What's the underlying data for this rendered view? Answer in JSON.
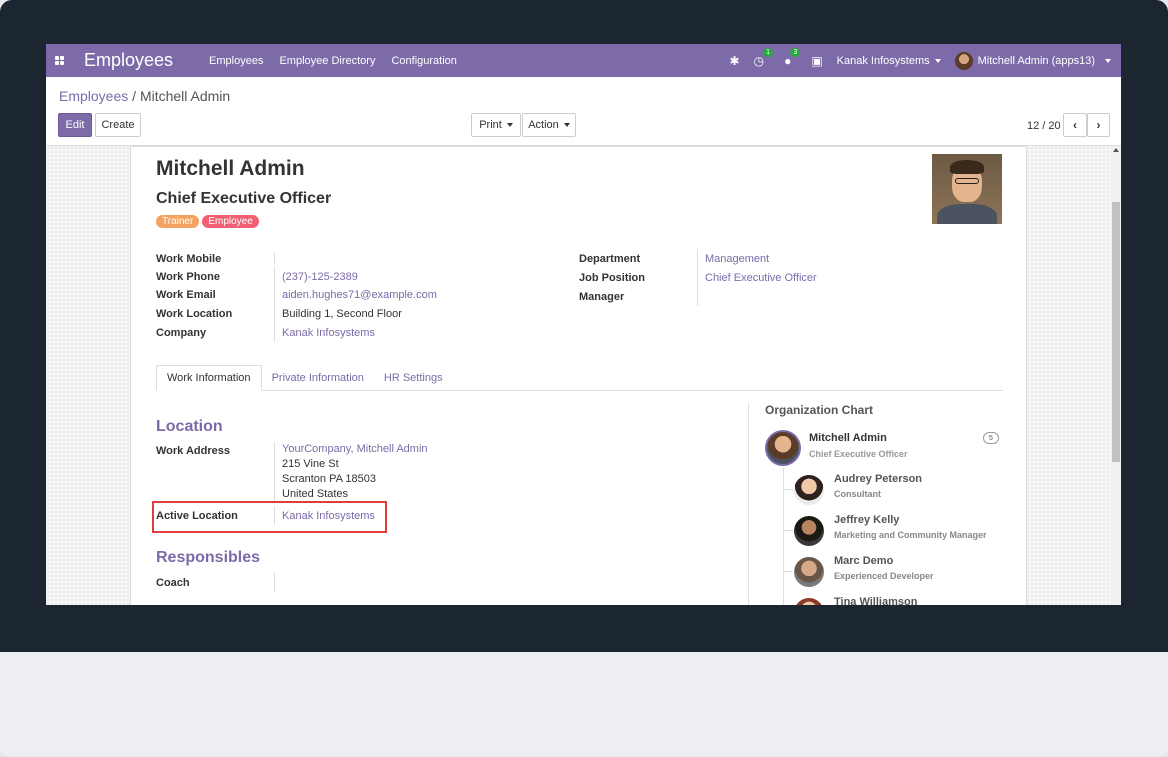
{
  "navbar": {
    "brand": "Employees",
    "menu": [
      "Employees",
      "Employee Directory",
      "Configuration"
    ],
    "activity_count": "1",
    "message_count": "3",
    "company": "Kanak Infosystems",
    "user": "Mitchell Admin (apps13)"
  },
  "control": {
    "breadcrumb_root": "Employees",
    "breadcrumb_sep": "/",
    "breadcrumb_current": "Mitchell Admin",
    "edit_label": "Edit",
    "create_label": "Create",
    "print_label": "Print",
    "action_label": "Action",
    "pager": "12 / 20"
  },
  "employee": {
    "name": "Mitchell Admin",
    "job_title": "Chief Executive Officer",
    "tags": [
      {
        "label": "Trainer",
        "color": "#f4a460"
      },
      {
        "label": "Employee",
        "color": "#f06072"
      }
    ],
    "left_fields": [
      {
        "label": "Work Mobile",
        "value": ""
      },
      {
        "label": "Work Phone",
        "value": "(237)-125-2389"
      },
      {
        "label": "Work Email",
        "value": "aiden.hughes71@example.com"
      },
      {
        "label": "Work Location",
        "value": "Building 1, Second Floor"
      },
      {
        "label": "Company",
        "value": "Kanak Infosystems"
      }
    ],
    "right_fields": [
      {
        "label": "Department",
        "value": "Management"
      },
      {
        "label": "Job Position",
        "value": "Chief Executive Officer"
      },
      {
        "label": "Manager",
        "value": ""
      }
    ]
  },
  "tabs": [
    "Work Information",
    "Private Information",
    "HR Settings"
  ],
  "location": {
    "title": "Location",
    "work_address_label": "Work Address",
    "address_lines": [
      "YourCompany, Mitchell Admin",
      "215 Vine St",
      "Scranton PA 18503",
      "United States"
    ],
    "active_location_label": "Active Location",
    "active_location_value": "Kanak Infosystems"
  },
  "responsibles": {
    "title": "Responsibles",
    "coach_label": "Coach"
  },
  "org_chart": {
    "title": "Organization Chart",
    "main": {
      "name": "Mitchell Admin",
      "role": "Chief Executive Officer",
      "count": "5"
    },
    "subordinates": [
      {
        "name": "Audrey Peterson",
        "role": "Consultant"
      },
      {
        "name": "Jeffrey Kelly",
        "role": "Marketing and Community Manager"
      },
      {
        "name": "Marc Demo",
        "role": "Experienced Developer"
      },
      {
        "name": "Tina Williamson",
        "role": ""
      }
    ]
  }
}
